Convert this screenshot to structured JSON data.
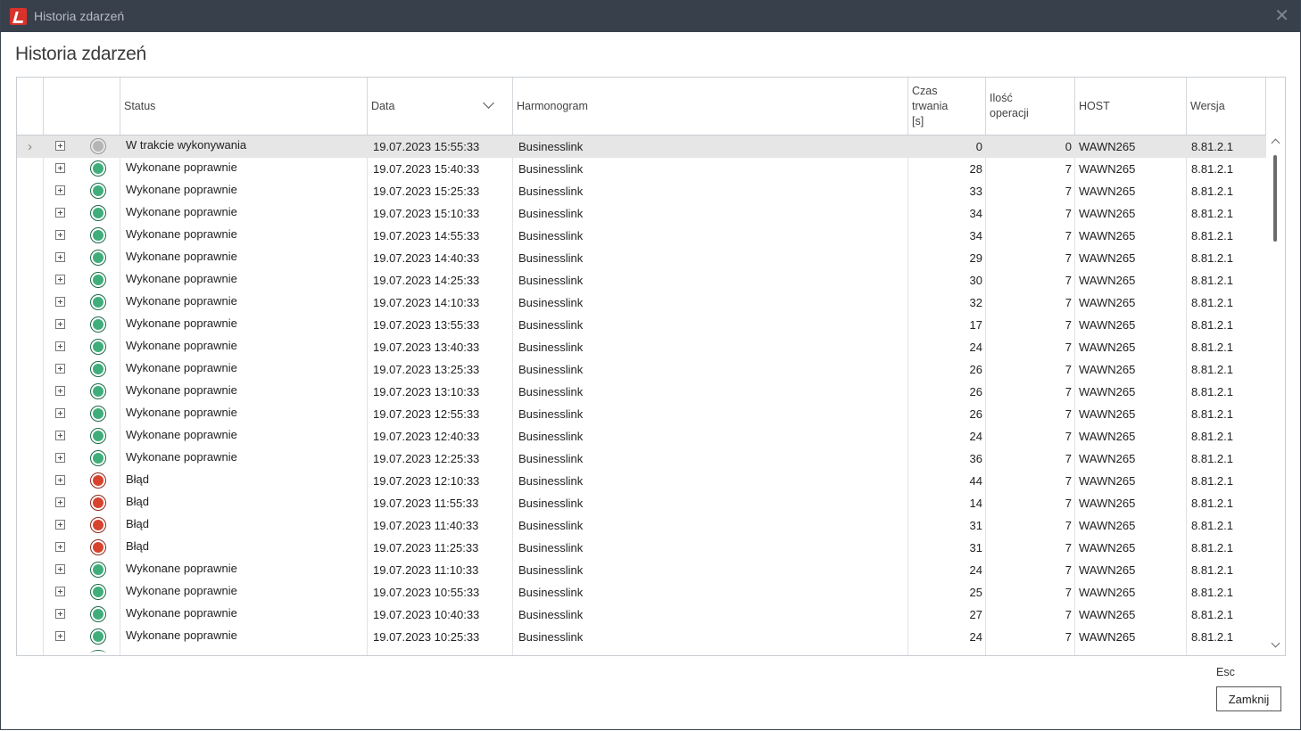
{
  "window": {
    "title": "Historia zdarzeń",
    "close_glyph": "✕"
  },
  "heading": "Historia zdarzeń",
  "columns": {
    "status": "Status",
    "data": "Data",
    "harmonogram": "Harmonogram",
    "czas": "Czas\ntrwania\n[s]",
    "ilosc": "Ilość\noperacji",
    "host": "HOST",
    "wersja": "Wersja"
  },
  "colors": {
    "ok": "#3fae7a",
    "error": "#d8432e",
    "running": "#b5b5b5"
  },
  "rows": [
    {
      "status": "W trakcie wykonywania",
      "kind": "running",
      "data": "19.07.2023 15:55:33",
      "harmonogram": "Businesslink",
      "czas": "0",
      "ilosc": "0",
      "host": "WAWN265",
      "wersja": "8.81.2.1",
      "selected": true
    },
    {
      "status": "Wykonane poprawnie",
      "kind": "ok",
      "data": "19.07.2023 15:40:33",
      "harmonogram": "Businesslink",
      "czas": "28",
      "ilosc": "7",
      "host": "WAWN265",
      "wersja": "8.81.2.1"
    },
    {
      "status": "Wykonane poprawnie",
      "kind": "ok",
      "data": "19.07.2023 15:25:33",
      "harmonogram": "Businesslink",
      "czas": "33",
      "ilosc": "7",
      "host": "WAWN265",
      "wersja": "8.81.2.1"
    },
    {
      "status": "Wykonane poprawnie",
      "kind": "ok",
      "data": "19.07.2023 15:10:33",
      "harmonogram": "Businesslink",
      "czas": "34",
      "ilosc": "7",
      "host": "WAWN265",
      "wersja": "8.81.2.1"
    },
    {
      "status": "Wykonane poprawnie",
      "kind": "ok",
      "data": "19.07.2023 14:55:33",
      "harmonogram": "Businesslink",
      "czas": "34",
      "ilosc": "7",
      "host": "WAWN265",
      "wersja": "8.81.2.1"
    },
    {
      "status": "Wykonane poprawnie",
      "kind": "ok",
      "data": "19.07.2023 14:40:33",
      "harmonogram": "Businesslink",
      "czas": "29",
      "ilosc": "7",
      "host": "WAWN265",
      "wersja": "8.81.2.1"
    },
    {
      "status": "Wykonane poprawnie",
      "kind": "ok",
      "data": "19.07.2023 14:25:33",
      "harmonogram": "Businesslink",
      "czas": "30",
      "ilosc": "7",
      "host": "WAWN265",
      "wersja": "8.81.2.1"
    },
    {
      "status": "Wykonane poprawnie",
      "kind": "ok",
      "data": "19.07.2023 14:10:33",
      "harmonogram": "Businesslink",
      "czas": "32",
      "ilosc": "7",
      "host": "WAWN265",
      "wersja": "8.81.2.1"
    },
    {
      "status": "Wykonane poprawnie",
      "kind": "ok",
      "data": "19.07.2023 13:55:33",
      "harmonogram": "Businesslink",
      "czas": "17",
      "ilosc": "7",
      "host": "WAWN265",
      "wersja": "8.81.2.1"
    },
    {
      "status": "Wykonane poprawnie",
      "kind": "ok",
      "data": "19.07.2023 13:40:33",
      "harmonogram": "Businesslink",
      "czas": "24",
      "ilosc": "7",
      "host": "WAWN265",
      "wersja": "8.81.2.1"
    },
    {
      "status": "Wykonane poprawnie",
      "kind": "ok",
      "data": "19.07.2023 13:25:33",
      "harmonogram": "Businesslink",
      "czas": "26",
      "ilosc": "7",
      "host": "WAWN265",
      "wersja": "8.81.2.1"
    },
    {
      "status": "Wykonane poprawnie",
      "kind": "ok",
      "data": "19.07.2023 13:10:33",
      "harmonogram": "Businesslink",
      "czas": "26",
      "ilosc": "7",
      "host": "WAWN265",
      "wersja": "8.81.2.1"
    },
    {
      "status": "Wykonane poprawnie",
      "kind": "ok",
      "data": "19.07.2023 12:55:33",
      "harmonogram": "Businesslink",
      "czas": "26",
      "ilosc": "7",
      "host": "WAWN265",
      "wersja": "8.81.2.1"
    },
    {
      "status": "Wykonane poprawnie",
      "kind": "ok",
      "data": "19.07.2023 12:40:33",
      "harmonogram": "Businesslink",
      "czas": "24",
      "ilosc": "7",
      "host": "WAWN265",
      "wersja": "8.81.2.1"
    },
    {
      "status": "Wykonane poprawnie",
      "kind": "ok",
      "data": "19.07.2023 12:25:33",
      "harmonogram": "Businesslink",
      "czas": "36",
      "ilosc": "7",
      "host": "WAWN265",
      "wersja": "8.81.2.1"
    },
    {
      "status": "Błąd",
      "kind": "error",
      "data": "19.07.2023 12:10:33",
      "harmonogram": "Businesslink",
      "czas": "44",
      "ilosc": "7",
      "host": "WAWN265",
      "wersja": "8.81.2.1"
    },
    {
      "status": "Błąd",
      "kind": "error",
      "data": "19.07.2023 11:55:33",
      "harmonogram": "Businesslink",
      "czas": "14",
      "ilosc": "7",
      "host": "WAWN265",
      "wersja": "8.81.2.1"
    },
    {
      "status": "Błąd",
      "kind": "error",
      "data": "19.07.2023 11:40:33",
      "harmonogram": "Businesslink",
      "czas": "31",
      "ilosc": "7",
      "host": "WAWN265",
      "wersja": "8.81.2.1"
    },
    {
      "status": "Błąd",
      "kind": "error",
      "data": "19.07.2023 11:25:33",
      "harmonogram": "Businesslink",
      "czas": "31",
      "ilosc": "7",
      "host": "WAWN265",
      "wersja": "8.81.2.1"
    },
    {
      "status": "Wykonane poprawnie",
      "kind": "ok",
      "data": "19.07.2023 11:10:33",
      "harmonogram": "Businesslink",
      "czas": "24",
      "ilosc": "7",
      "host": "WAWN265",
      "wersja": "8.81.2.1"
    },
    {
      "status": "Wykonane poprawnie",
      "kind": "ok",
      "data": "19.07.2023 10:55:33",
      "harmonogram": "Businesslink",
      "czas": "25",
      "ilosc": "7",
      "host": "WAWN265",
      "wersja": "8.81.2.1"
    },
    {
      "status": "Wykonane poprawnie",
      "kind": "ok",
      "data": "19.07.2023 10:40:33",
      "harmonogram": "Businesslink",
      "czas": "27",
      "ilosc": "7",
      "host": "WAWN265",
      "wersja": "8.81.2.1"
    },
    {
      "status": "Wykonane poprawnie",
      "kind": "ok",
      "data": "19.07.2023 10:25:33",
      "harmonogram": "Businesslink",
      "czas": "24",
      "ilosc": "7",
      "host": "WAWN265",
      "wersja": "8.81.2.1"
    }
  ],
  "footer": {
    "shortcut": "Esc",
    "close_label": "Zamknij"
  }
}
